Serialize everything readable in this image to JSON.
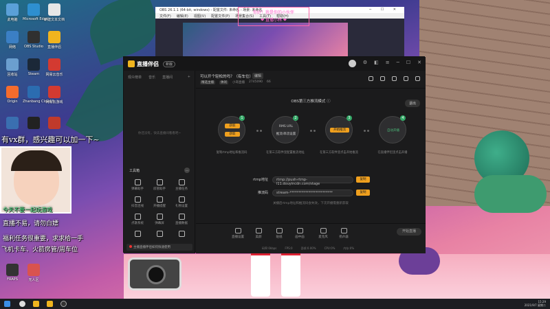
{
  "desktop_icons": [
    {
      "label": "此电脑",
      "color": "#5aa0d8"
    },
    {
      "label": "Microsoft Edge",
      "color": "#2e8fd0"
    },
    {
      "label": "新建文本文档",
      "color": "#e6e6e6"
    },
    {
      "label": "网络",
      "color": "#3b7fc4"
    },
    {
      "label": "OBS Studio",
      "color": "#303030"
    },
    {
      "label": "直播伴侣",
      "color": "#f0b41e"
    },
    {
      "label": "回收站",
      "color": "#6b9fcf"
    },
    {
      "label": "Steam",
      "color": "#1b2838"
    },
    {
      "label": "网易云音乐",
      "color": "#d33a31"
    },
    {
      "label": "Origin",
      "color": "#f56c2d"
    },
    {
      "label": "Zhanbang Cloud 5",
      "color": "#2b6cb0"
    },
    {
      "label": "网易云游戏",
      "color": "#d33a31"
    },
    {
      "label": "",
      "color": "#3a6fb0"
    },
    {
      "label": "",
      "color": "#222222"
    },
    {
      "label": "",
      "color": "#c03a2b"
    },
    {
      "label": "FRAPS",
      "color": "#333333"
    },
    {
      "label": "无人区",
      "color": "#d9534f"
    }
  ],
  "obs": {
    "title": "OBS 26.1.1 (64-bit, windows) - 配置文件: 未命名 - 场景: 未命名",
    "menu": [
      "文件(F)",
      "编辑(E)",
      "视图(V)",
      "配置文件(P)",
      "场景集合(S)",
      "工具(T)",
      "帮助(H)"
    ],
    "overlay_line1": "你好！我是你的小伙伴",
    "overlay_line2": "❤ 直播小林 ❤"
  },
  "app": {
    "name": "直播伴侣",
    "version": "新版",
    "left_tabs": [
      "观众榜单",
      "音乐",
      "直播间"
    ],
    "left_empty": "你还没有，快去直播间看看吧~",
    "tools_title": "工具箱",
    "tools": [
      "弹幕助手",
      "房管助手",
      "主播任务",
      "抖音连线",
      "开播提醒",
      "礼物设置",
      "点歌系统",
      "弹幕屏",
      "直播数据",
      "",
      "",
      ""
    ],
    "left_bar": "主播直播伴侣如何快速使用",
    "room_title": "可以开个轻松的吗？（有车位）",
    "room_edit": "编辑",
    "room_tag": "精选主播",
    "room_category": "休闲",
    "room_id": "小哥直播",
    "room_number": "2745090",
    "room_count": "66",
    "mode": "OBS第三方推流模式",
    "quit": "退出",
    "steps": [
      {
        "num": "1",
        "btn1": "获取",
        "btn2": "获取",
        "desc": "复制rtmp地址和推流码"
      },
      {
        "num": "2",
        "line1": "RMS URL",
        "line2": "推流/串流设置",
        "desc": "在第三方软件里配置推流地址"
      },
      {
        "num": "3",
        "btn1": "开始推流",
        "desc": "在第三方软件里点击开始推流"
      },
      {
        "num": "4",
        "line1": "自动开播",
        "desc": "在直播伴侣里点击开播"
      }
    ],
    "rtmp_label": "rtmp地址",
    "rtmp_value": "rtmp://push-rtmp-l11.douyincdn.com/stage",
    "key_label": "推流码",
    "key_value": "stream-*************************",
    "copy_label": "复制",
    "note": "关播后rtmp地址和推流码会失效，下次开播需重新获取",
    "bottom_tools": [
      "直播设置",
      "美颜",
      "贴纸",
      "画中画",
      "麦克风",
      "扬声器"
    ],
    "start_live": "开始直播",
    "stats": [
      "码率:0kbps",
      "FPS:0",
      "丢帧:0.00%",
      "CPU:0%",
      "内存:0%"
    ]
  },
  "overlays": {
    "sub1": "有vx群，感兴趣可以加一下~",
    "sub2": "今天不要一起玩游戏",
    "sub3": "直播不易，请勿白嫖",
    "sub4": "福利任务很重要，求求给一手",
    "sub5": "飞机卡车、火箭房管/周车位"
  },
  "taskbar": {
    "time": "15:29",
    "date": "2021/9/7 星期二"
  }
}
